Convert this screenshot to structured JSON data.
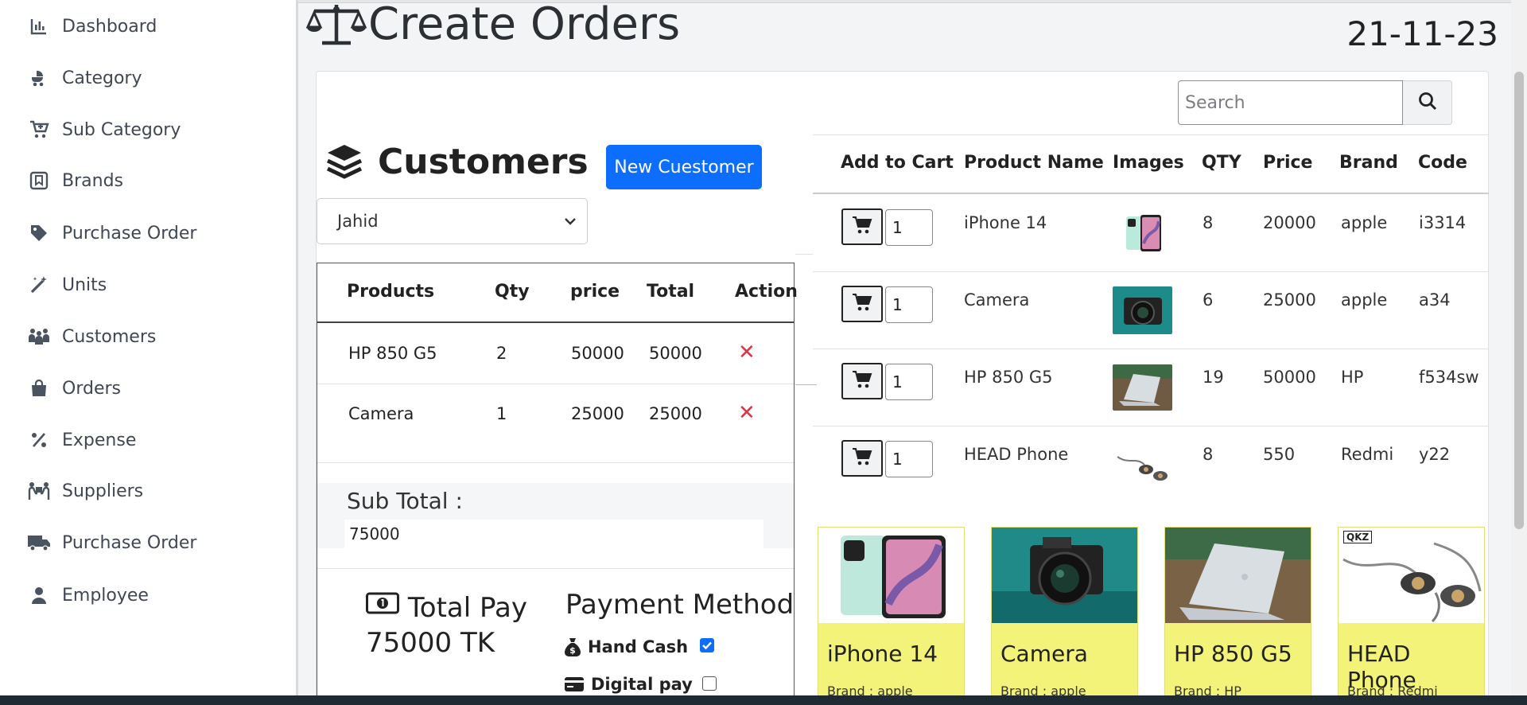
{
  "sidebar": {
    "items": [
      {
        "label": "Dashboard",
        "icon": "chart-icon"
      },
      {
        "label": "Category",
        "icon": "stroller-icon"
      },
      {
        "label": "Sub Category",
        "icon": "cart-plus-icon"
      },
      {
        "label": "Brands",
        "icon": "bookmark-icon"
      },
      {
        "label": "Purchase Order",
        "icon": "tag-icon"
      },
      {
        "label": "Units",
        "icon": "magic-wand-icon"
      },
      {
        "label": "Customers",
        "icon": "people-icon"
      },
      {
        "label": "Orders",
        "icon": "shopping-bag-icon"
      },
      {
        "label": "Expense",
        "icon": "percent-icon"
      },
      {
        "label": "Suppliers",
        "icon": "people-carry-icon"
      },
      {
        "label": "Purchase Order",
        "icon": "truck-icon"
      },
      {
        "label": "Employee",
        "icon": "user-icon"
      }
    ]
  },
  "header": {
    "title": "Create Orders",
    "date": "21-11-23"
  },
  "search": {
    "placeholder": "Search"
  },
  "customers": {
    "title": "Customers",
    "new_button": "New Cuestomer",
    "selected": "Jahid"
  },
  "cart": {
    "headers": [
      "Products",
      "Qty",
      "price",
      "Total",
      "Action"
    ],
    "rows": [
      {
        "product": "HP 850 G5",
        "qty": "2",
        "price": "50000",
        "total": "50000"
      },
      {
        "product": "Camera",
        "qty": "1",
        "price": "25000",
        "total": "25000"
      }
    ],
    "subtotal_label": "Sub Total :",
    "subtotal_value": "75000"
  },
  "payment": {
    "total_label": "Total Pay",
    "total_value": "75000 TK",
    "method_title": "Payment Method",
    "options": [
      {
        "label": "Hand Cash",
        "checked": true
      },
      {
        "label": "Digital pay",
        "checked": false
      }
    ]
  },
  "products": {
    "headers": [
      "Add to Cart",
      "Product Name",
      "Images",
      "QTY",
      "Price",
      "Brand",
      "Code"
    ],
    "rows": [
      {
        "qty_input": "1",
        "name": "iPhone 14",
        "qty": "8",
        "price": "20000",
        "brand": "apple",
        "code": "i3314"
      },
      {
        "qty_input": "1",
        "name": "Camera",
        "qty": "6",
        "price": "25000",
        "brand": "apple",
        "code": "a34"
      },
      {
        "qty_input": "1",
        "name": "HP 850 G5",
        "qty": "19",
        "price": "50000",
        "brand": "HP",
        "code": "f534sw"
      },
      {
        "qty_input": "1",
        "name": "HEAD Phone",
        "qty": "8",
        "price": "550",
        "brand": "Redmi",
        "code": "y22"
      }
    ]
  },
  "cards": [
    {
      "name": "iPhone 14",
      "brand": "Brand : apple"
    },
    {
      "name": "Camera",
      "brand": "Brand : apple"
    },
    {
      "name": "HP 850 G5",
      "brand": "Brand : HP"
    },
    {
      "name": "HEAD Phone",
      "brand": "Brand : Redmi"
    }
  ],
  "card_logo": "QKZ",
  "colors": {
    "primary": "#0d6efd",
    "danger": "#dc3545",
    "card_bg": "#f3f37a"
  }
}
